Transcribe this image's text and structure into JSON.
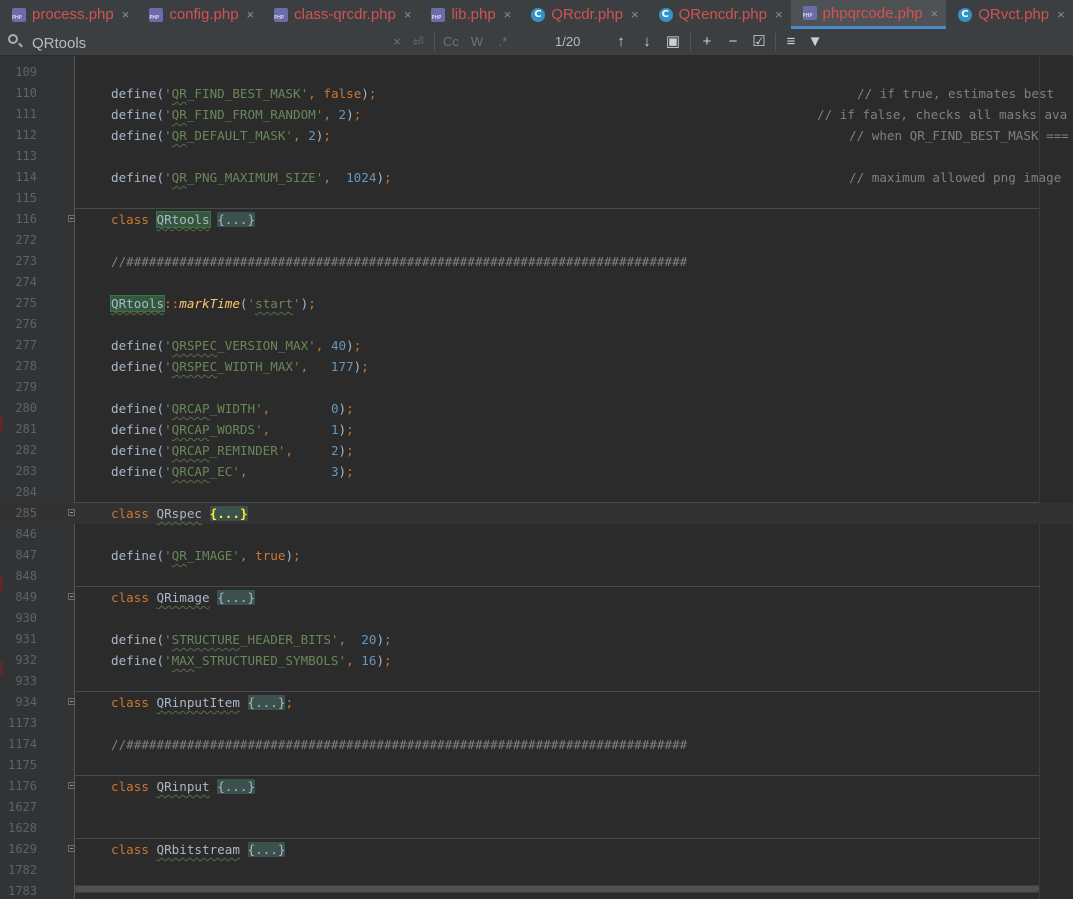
{
  "tabs": [
    {
      "label": "process.php",
      "icon": "php-file-icon",
      "active": false
    },
    {
      "label": "config.php",
      "icon": "php-file-icon",
      "active": false
    },
    {
      "label": "class-qrcdr.php",
      "icon": "php-file-icon",
      "active": false
    },
    {
      "label": "lib.php",
      "icon": "php-file-icon",
      "active": false
    },
    {
      "label": "QRcdr.php",
      "icon": "php-class-icon",
      "active": false
    },
    {
      "label": "QRencdr.php",
      "icon": "php-class-icon",
      "active": false
    },
    {
      "label": "phpqrcode.php",
      "icon": "php-file-icon",
      "active": true
    },
    {
      "label": "QRvct.php",
      "icon": "php-class-icon",
      "active": false
    }
  ],
  "close_glyph": "×",
  "search": {
    "query": "QRtools",
    "match_count": "1/20",
    "match_case_label": "Cc",
    "words_label": "W",
    "regex_label": ".*"
  },
  "lines": [
    {
      "num": "109"
    },
    {
      "num": "110",
      "code": "define('QR_FIND_BEST_MASK', false);",
      "comment": "// if true, estimates best"
    },
    {
      "num": "111",
      "code": "define('QR_FIND_FROM_RANDOM', 2);",
      "comment": "// if false, checks all masks ava"
    },
    {
      "num": "112",
      "code": "define('QR_DEFAULT_MASK', 2);",
      "comment": "// when QR_FIND_BEST_MASK ==="
    },
    {
      "num": "113"
    },
    {
      "num": "114",
      "code": "define('QR_PNG_MAXIMUM_SIZE',  1024);",
      "comment": "// maximum allowed png image"
    },
    {
      "num": "115"
    },
    {
      "num": "116",
      "code": "class QRtools {...}"
    },
    {
      "num": "272"
    },
    {
      "num": "273",
      "code": "//##########################################################################"
    },
    {
      "num": "274"
    },
    {
      "num": "275",
      "code": "QRtools::markTime('start');"
    },
    {
      "num": "276"
    },
    {
      "num": "277",
      "code": "define('QRSPEC_VERSION_MAX', 40);"
    },
    {
      "num": "278",
      "code": "define('QRSPEC_WIDTH_MAX',   177);"
    },
    {
      "num": "279"
    },
    {
      "num": "280",
      "code": "define('QRCAP_WIDTH',        0);"
    },
    {
      "num": "281",
      "code": "define('QRCAP_WORDS',        1);"
    },
    {
      "num": "282",
      "code": "define('QRCAP_REMINDER',     2);"
    },
    {
      "num": "283",
      "code": "define('QRCAP_EC',           3);"
    },
    {
      "num": "284"
    },
    {
      "num": "285",
      "code": "class QRspec {...}"
    },
    {
      "num": "846"
    },
    {
      "num": "847",
      "code": "define('QR_IMAGE', true);"
    },
    {
      "num": "848"
    },
    {
      "num": "849",
      "code": "class QRimage {...}"
    },
    {
      "num": "930"
    },
    {
      "num": "931",
      "code": "define('STRUCTURE_HEADER_BITS',  20);"
    },
    {
      "num": "932",
      "code": "define('MAX_STRUCTURED_SYMBOLS', 16);"
    },
    {
      "num": "933"
    },
    {
      "num": "934",
      "code": "class QRinputItem {...};"
    },
    {
      "num": "1173"
    },
    {
      "num": "1174",
      "code": "//##########################################################################"
    },
    {
      "num": "1175"
    },
    {
      "num": "1176",
      "code": "class QRinput {...}"
    },
    {
      "num": "1627"
    },
    {
      "num": "1628"
    },
    {
      "num": "1629",
      "code": "class QRbitstream {...}"
    },
    {
      "num": "1782"
    },
    {
      "num": "1783"
    }
  ],
  "colors": {
    "background": "#2b2b2b",
    "keyword": "#cc7832",
    "string": "#6a8759",
    "number": "#6897bb",
    "function": "#ffc66d",
    "comment": "#808080",
    "search_highlight": "#32593d",
    "tab_text": "#d25252",
    "tab_active_underline": "#4a88c7"
  }
}
